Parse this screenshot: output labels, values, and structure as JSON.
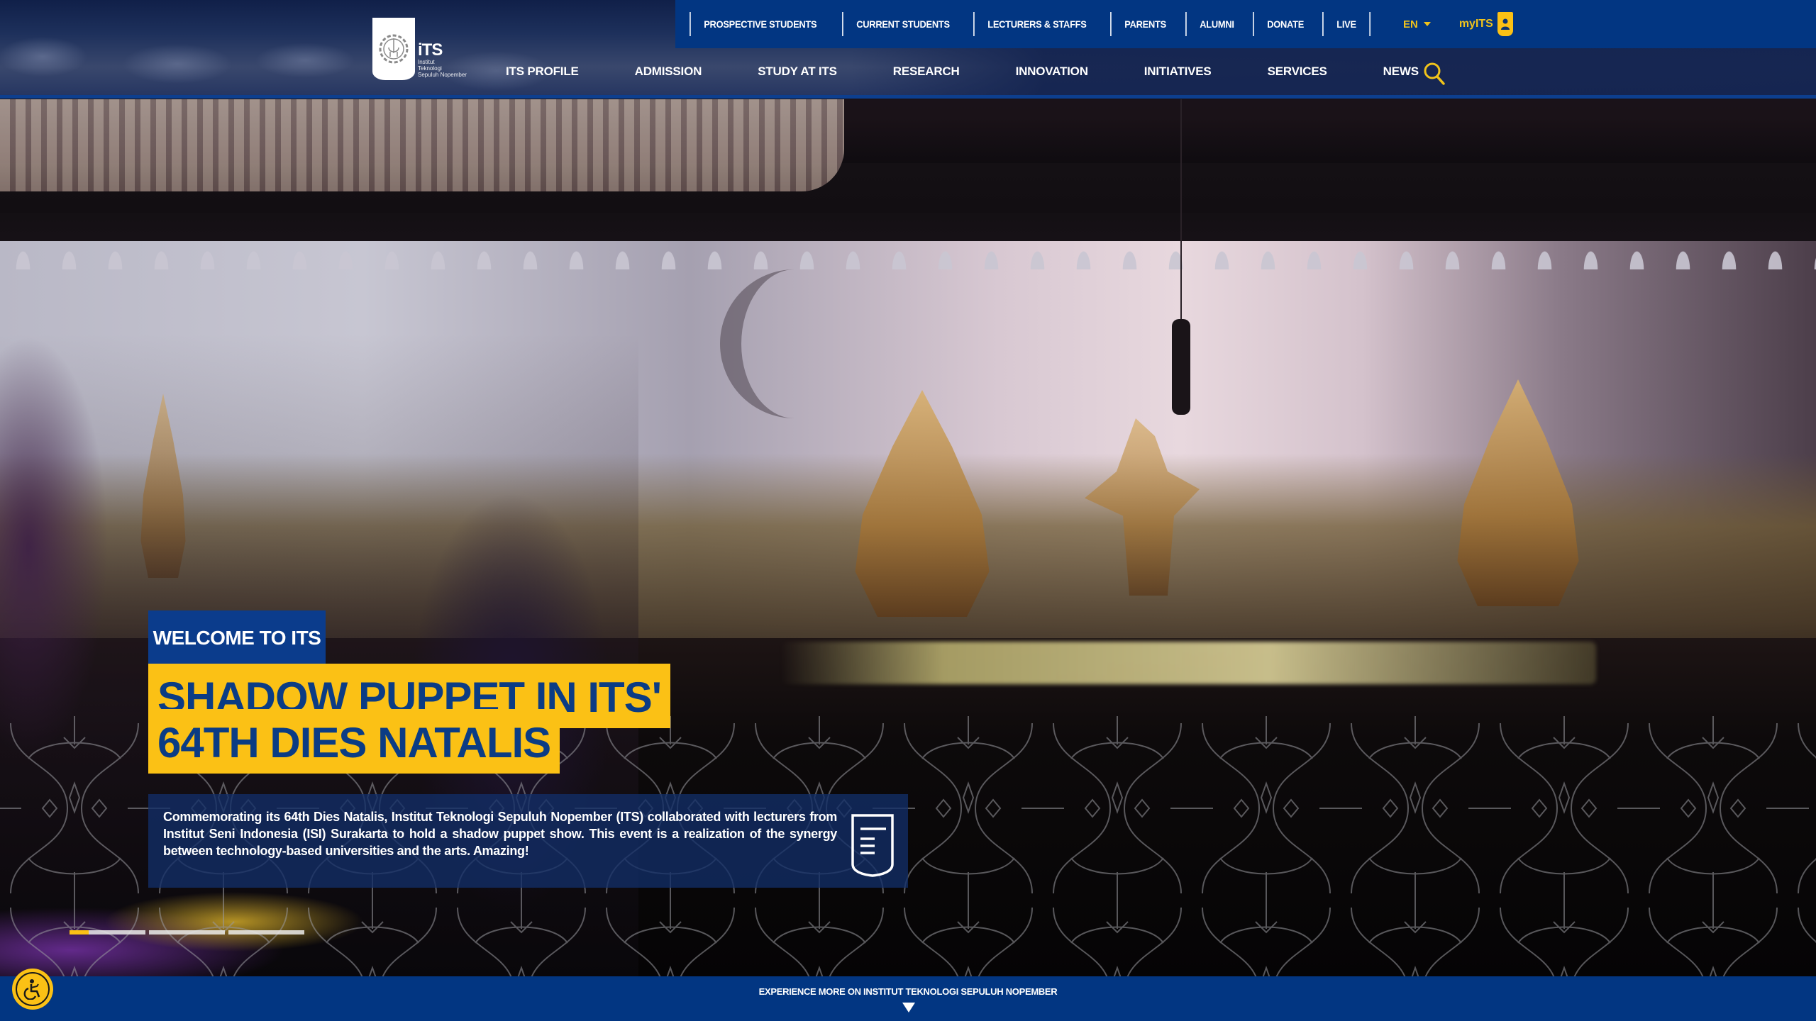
{
  "utility_nav": {
    "items": [
      "PROSPECTIVE STUDENTS",
      "CURRENT STUDENTS",
      "LECTURERS & STAFFS",
      "PARENTS",
      "ALUMNI",
      "DONATE",
      "LIVE"
    ],
    "language": "EN",
    "portal_label": "myITS"
  },
  "logo": {
    "short": "iTS",
    "line1": "Institut",
    "line2": "Teknologi",
    "line3": "Sepuluh Nopember"
  },
  "main_nav": {
    "items": [
      "ITS PROFILE",
      "ADMISSION",
      "STUDY AT ITS",
      "RESEARCH",
      "INNOVATION",
      "INITIATIVES",
      "SERVICES",
      "NEWS"
    ],
    "search_icon": "search-icon"
  },
  "hero": {
    "eyebrow": "WELCOME TO ITS",
    "headline": "SHADOW PUPPET IN ITS' 64TH DIES NATALIS",
    "description": "Commemorating its 64th Dies Natalis, Institut Teknologi Sepuluh Nopember (ITS) collaborated with lecturers from Institut Seni Indonesia (ISI) Surakarta to hold a shadow puppet show. This event is a realization of the synergy between technology-based universities and the arts. Amazing!",
    "read_more_icon": "document-icon",
    "slides": [
      {
        "progress": 0.25,
        "active": true
      },
      {
        "progress": 0,
        "active": false
      },
      {
        "progress": 0,
        "active": false
      }
    ]
  },
  "footer_bar": {
    "explore_label": "EXPERIENCE MORE ON INSTITUT TEKNOLOGI SEPULUH NOPEMBER",
    "accessibility_icon": "wheelchair-icon"
  },
  "colors": {
    "brand_blue": "#023682",
    "accent_yellow": "#fbc115",
    "headline_blue": "#0b3c84"
  }
}
